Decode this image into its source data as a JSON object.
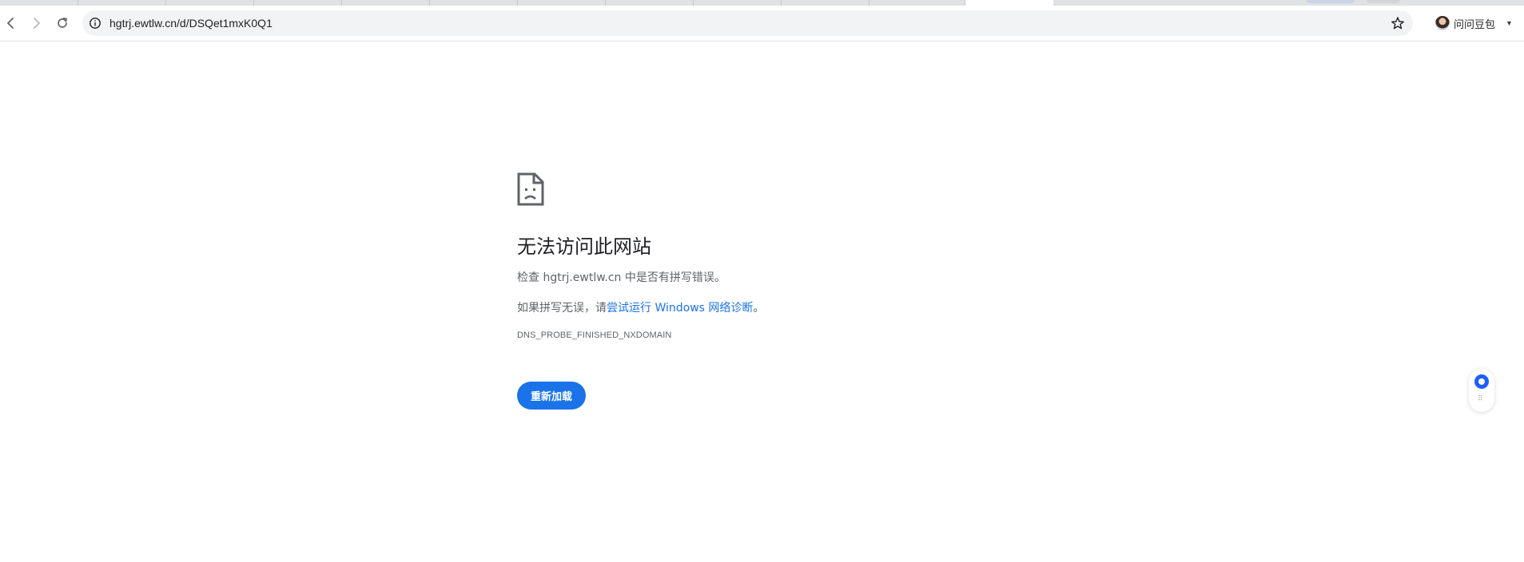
{
  "browser": {
    "url": "hgtrj.ewtlw.cn/d/DSQet1mxK0Q1",
    "profile_name": "问问豆包",
    "profile_caret": "▼"
  },
  "error": {
    "heading": "无法访问此网站",
    "check_text_prefix": "检查 ",
    "check_host": "hgtrj.ewtlw.cn",
    "check_text_suffix": " 中是否有拼写错误。",
    "spelling_prefix": "如果拼写无误，请",
    "diagnostics_link": "尝试运行 Windows 网络诊断",
    "spelling_suffix": "。",
    "error_code": "DNS_PROBE_FINISHED_NXDOMAIN",
    "reload_label": "重新加载"
  },
  "side_widget": {
    "grip_glyph": "⠿"
  },
  "colors": {
    "accent": "#1a73e8",
    "text_primary": "#202124",
    "text_secondary": "#5f6368",
    "widget_brand": "#1f5eff"
  },
  "icons": [
    "back-icon",
    "forward-icon",
    "reload-icon",
    "site-info-icon",
    "bookmark-star-icon",
    "sad-page-icon",
    "doubao-logo-icon"
  ]
}
